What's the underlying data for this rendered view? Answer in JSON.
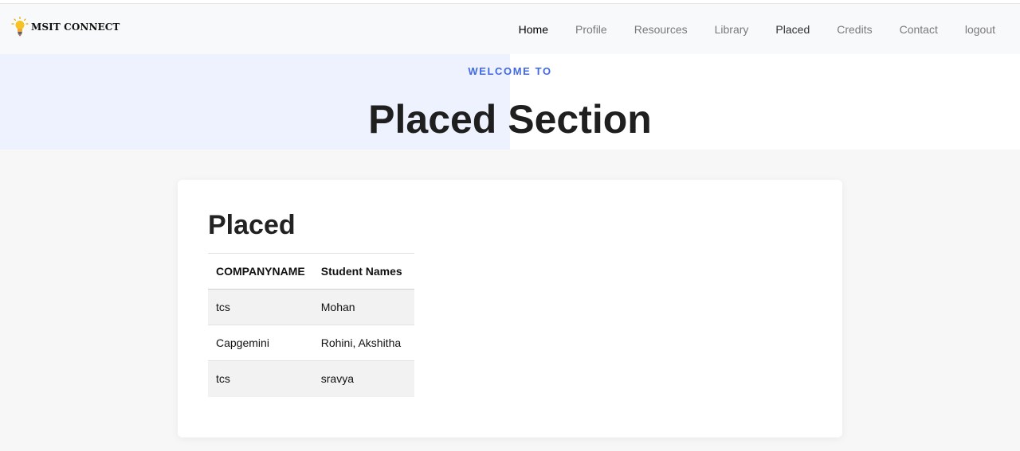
{
  "brand": {
    "name": "MSIT CONNECT",
    "icon": "lightbulb-icon"
  },
  "nav": {
    "items": [
      {
        "label": "Home"
      },
      {
        "label": "Profile"
      },
      {
        "label": "Resources"
      },
      {
        "label": "Library"
      },
      {
        "label": "Placed"
      },
      {
        "label": "Credits"
      },
      {
        "label": "Contact"
      },
      {
        "label": "logout"
      }
    ]
  },
  "hero": {
    "eyebrow": "WELCOME TO",
    "title": "Placed Section"
  },
  "card": {
    "title": "Placed",
    "table": {
      "headers": [
        "COMPANYNAME",
        "Student Names"
      ],
      "rows": [
        [
          "tcs",
          "Mohan"
        ],
        [
          "Capgemini",
          "Rohini, Akshitha"
        ],
        [
          "tcs",
          "sravya"
        ]
      ]
    }
  },
  "colors": {
    "accent": "#4169e1",
    "hero_tint": "#eef1fe",
    "navbar_bg": "#f8f9fa",
    "row_stripe": "#f2f2f2"
  }
}
